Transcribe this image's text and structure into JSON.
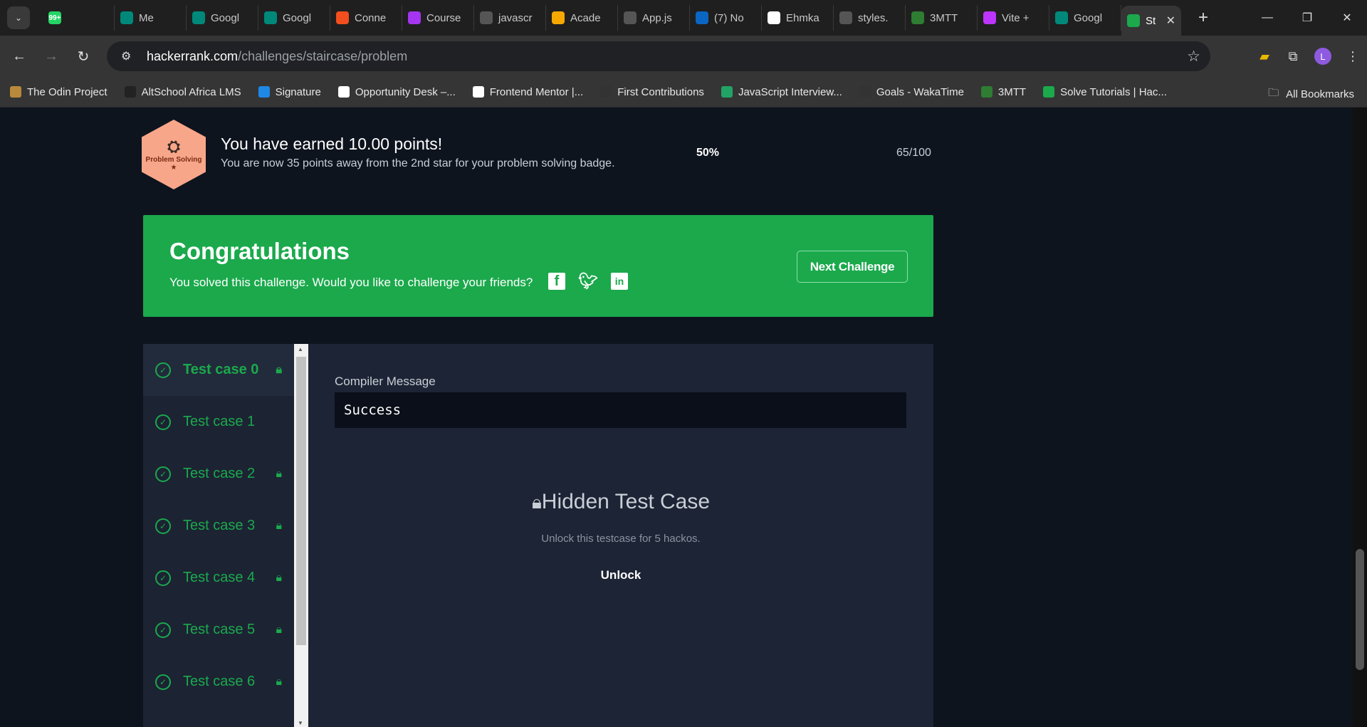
{
  "browser": {
    "tabs": [
      {
        "label": "",
        "icon": "whatsapp-icon",
        "color": "#25d366",
        "badge": "99+"
      },
      {
        "label": "Me",
        "icon": "meet-icon",
        "color": "#00897b"
      },
      {
        "label": "Googl",
        "icon": "meet-icon",
        "color": "#00897b"
      },
      {
        "label": "Googl",
        "icon": "meet-icon",
        "color": "#00897b"
      },
      {
        "label": "Conne",
        "icon": "figma-icon",
        "color": "#f24e1e"
      },
      {
        "label": "Course",
        "icon": "udemy-icon",
        "color": "#a435f0"
      },
      {
        "label": "javascr",
        "icon": "page-icon",
        "color": "#555555"
      },
      {
        "label": "Acade",
        "icon": "bookmark-icon",
        "color": "#f7a800"
      },
      {
        "label": "App.js",
        "icon": "page-icon",
        "color": "#555555"
      },
      {
        "label": "(7) No",
        "icon": "linkedin-icon",
        "color": "#0a66c2"
      },
      {
        "label": "Ehmka",
        "icon": "github-icon",
        "color": "#ffffff"
      },
      {
        "label": "styles.",
        "icon": "page-icon",
        "color": "#555555"
      },
      {
        "label": "3MTT",
        "icon": "3mtt-icon",
        "color": "#2e7d32"
      },
      {
        "label": "Vite +",
        "icon": "vite-icon",
        "color": "#bd34fe"
      },
      {
        "label": "Googl",
        "icon": "meet-icon",
        "color": "#00897b"
      },
      {
        "label": "St",
        "icon": "hackerrank-icon",
        "color": "#1ba94c",
        "active": true
      }
    ],
    "url_host": "hackerrank.com",
    "url_path": "/challenges/staircase/problem",
    "avatar_letter": "L",
    "bookmarks": [
      {
        "label": "The Odin Project",
        "color": "#b98a3b"
      },
      {
        "label": "AltSchool Africa LMS",
        "color": "#222222"
      },
      {
        "label": "Signature",
        "color": "#1e88e5"
      },
      {
        "label": "Opportunity Desk –...",
        "color": "#ffffff"
      },
      {
        "label": "Frontend Mentor |...",
        "color": "#ffffff"
      },
      {
        "label": "First Contributions",
        "color": "#333333"
      },
      {
        "label": "JavaScript Interview...",
        "color": "#21a366"
      },
      {
        "label": "Goals - WakaTime",
        "color": "#333333"
      },
      {
        "label": "3MTT",
        "color": "#2e7d32"
      },
      {
        "label": "Solve Tutorials | Hac...",
        "color": "#1ba94c"
      }
    ],
    "all_bookmarks": "All Bookmarks"
  },
  "progress": {
    "badge_label": "Problem Solving",
    "badge_star": "★",
    "title": "You have earned 10.00 points!",
    "subtitle": "You are now 35 points away from the 2nd star for your problem solving badge.",
    "percent": "50%",
    "score": "65/100"
  },
  "congrats": {
    "title": "Congratulations",
    "message": "You solved this challenge. Would you like to challenge your friends?",
    "next_button": "Next Challenge"
  },
  "test_cases": [
    {
      "label": "Test case 0",
      "locked": true,
      "active": true
    },
    {
      "label": "Test case 1",
      "locked": false
    },
    {
      "label": "Test case 2",
      "locked": true
    },
    {
      "label": "Test case 3",
      "locked": true
    },
    {
      "label": "Test case 4",
      "locked": true
    },
    {
      "label": "Test case 5",
      "locked": true
    },
    {
      "label": "Test case 6",
      "locked": true
    }
  ],
  "detail": {
    "compiler_label": "Compiler Message",
    "compiler_value": "Success",
    "hidden_title": "Hidden Test Case",
    "hidden_sub": "Unlock this testcase for 5 hackos.",
    "unlock": "Unlock"
  }
}
